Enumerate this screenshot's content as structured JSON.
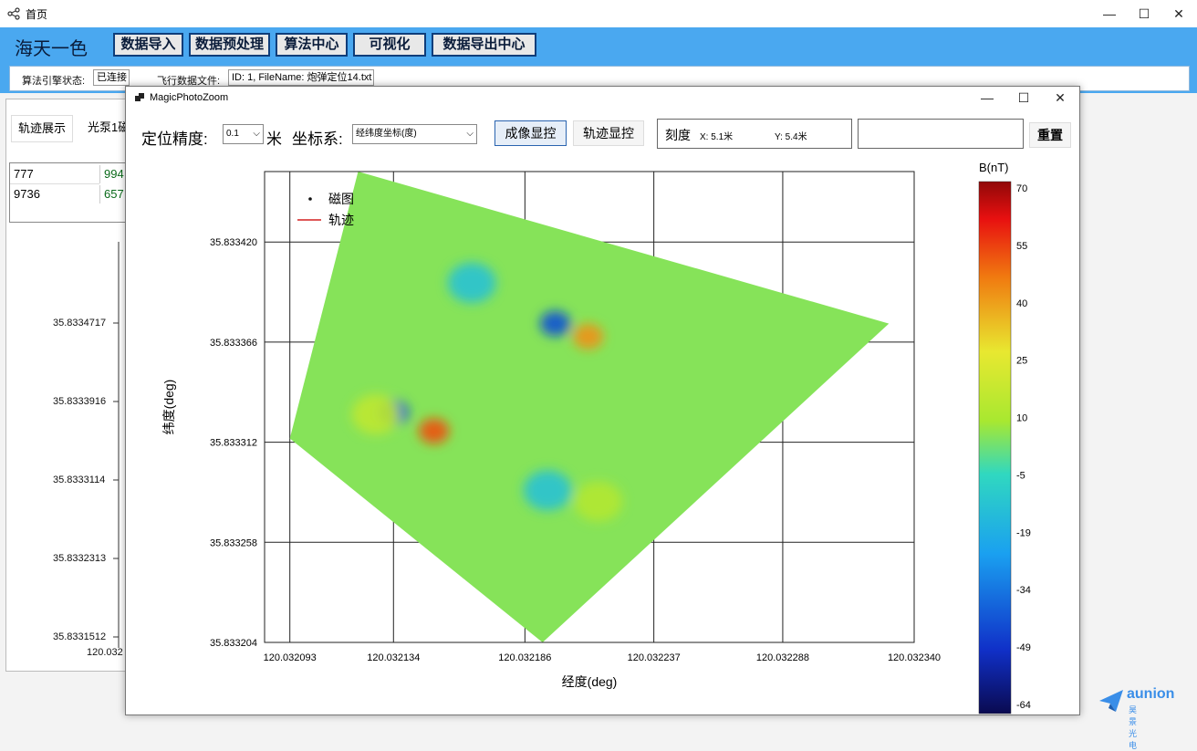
{
  "main_window": {
    "title": "首页",
    "controls": {
      "minimize": "—",
      "maximize": "☐",
      "close": "✕"
    }
  },
  "app": {
    "brand": "海天一色",
    "menu": [
      "数据导入",
      "数据预处理",
      "算法中心",
      "可视化",
      "数据导出中心"
    ]
  },
  "status": {
    "engine_label": "算法引擎状态:",
    "engine_value": "已连接",
    "file_label": "飞行数据文件:",
    "file_value": "ID: 1, FileName: 炮弹定位14.txt"
  },
  "left_panel": {
    "buttons": [
      "轨迹展示",
      "光泵1磁"
    ],
    "grid": [
      [
        "777",
        "994"
      ],
      [
        "9736",
        "657"
      ]
    ],
    "y_ticks": [
      "35.8334717",
      "35.8333916",
      "35.8333114",
      "35.8332313",
      "35.8331512"
    ],
    "x_tick": "120.032"
  },
  "popup": {
    "title": "MagicPhotoZoom",
    "controls": {
      "minimize": "—",
      "maximize": "☐",
      "close": "✕"
    },
    "accuracy_label": "定位精度:",
    "accuracy_value": "0.1",
    "accuracy_unit": "米",
    "coord_label": "坐标系:",
    "coord_value": "经纬度坐标(度)",
    "btn_imaging": "成像显控",
    "btn_track": "轨迹显控",
    "scale_label": "刻度",
    "scale_x": "X: 5.1米",
    "scale_y": "Y: 5.4米",
    "reset": "重置"
  },
  "chart_data": {
    "type": "heatmap",
    "xlabel": "经度(deg)",
    "ylabel": "纬度(deg)",
    "x_ticks": [
      "120.032093",
      "120.032134",
      "120.032186",
      "120.032237",
      "120.032288",
      "120.032340"
    ],
    "y_ticks": [
      "35.833420",
      "35.833366",
      "35.833312",
      "35.833258",
      "35.833204"
    ],
    "xlim": [
      120.032083,
      120.03234
    ],
    "ylim": [
      35.833204,
      35.833458
    ],
    "legend": [
      "磁图",
      "轨迹"
    ],
    "colorbar": {
      "label": "B(nT)",
      "ticks": [
        "70",
        "55",
        "40",
        "25",
        "10",
        "-5",
        "-19",
        "-34",
        "-49",
        "-64"
      ],
      "range": [
        -64,
        74
      ]
    },
    "survey_area": [
      [
        120.03212,
        35.833458
      ],
      [
        120.032093,
        35.833314
      ],
      [
        120.032193,
        35.833204
      ],
      [
        120.03233,
        35.833376
      ]
    ],
    "background_value": 8,
    "anomalies": [
      {
        "x": 120.032134,
        "y": 35.833328,
        "value": -40
      },
      {
        "x": 120.03215,
        "y": 35.833318,
        "value": 55
      },
      {
        "x": 120.032198,
        "y": 35.833376,
        "value": -40
      },
      {
        "x": 120.032211,
        "y": 35.833369,
        "value": 45
      },
      {
        "x": 120.032165,
        "y": 35.833398,
        "value": -10
      },
      {
        "x": 120.032195,
        "y": 35.833286,
        "value": -10
      },
      {
        "x": 120.032215,
        "y": 35.83328,
        "value": 15
      },
      {
        "x": 120.032127,
        "y": 35.833327,
        "value": 18
      }
    ]
  },
  "colors": {
    "menubar": "#4aa8f0",
    "accent": "#2a64b0",
    "track": "#d42020"
  },
  "watermark": {
    "brand": "aunion",
    "sub": "昊景光电"
  }
}
